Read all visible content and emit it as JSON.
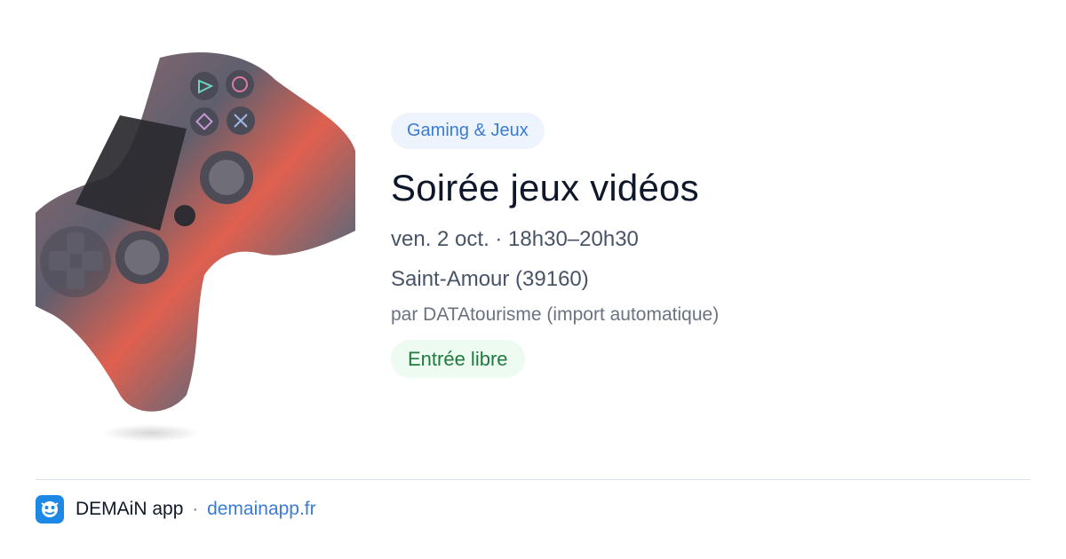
{
  "event": {
    "category": "Gaming & Jeux",
    "title": "Soirée jeux vidéos",
    "datetime": "ven. 2 oct. · 18h30–20h30",
    "location": "Saint-Amour (39160)",
    "source": "par DATAtourisme (import automatique)",
    "price": "Entrée libre",
    "image_icon": "game-controller"
  },
  "footer": {
    "app_name": "DEMAiN app",
    "separator": "·",
    "url": "demainapp.fr"
  },
  "colors": {
    "accent": "#3a7bd5",
    "category_bg": "#eef4fd",
    "price_text": "#1f7a3e",
    "price_bg": "#eefbf1",
    "logo_bg": "#1e88e5"
  }
}
